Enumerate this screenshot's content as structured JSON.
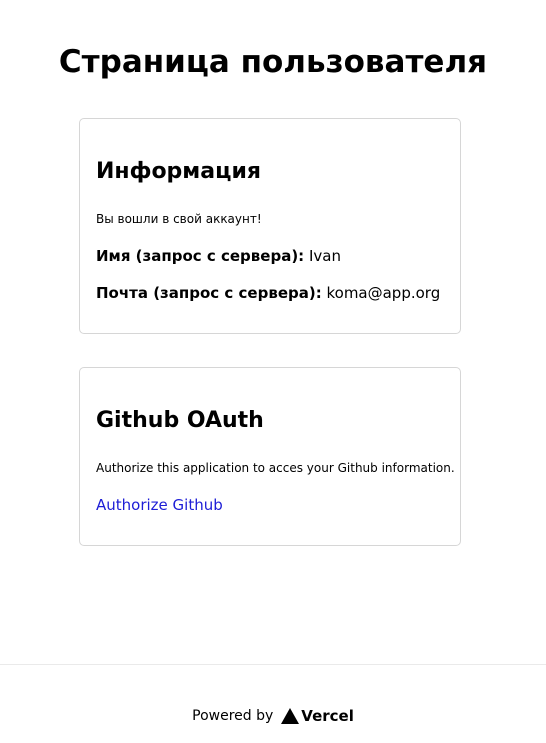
{
  "page": {
    "title": "Страница пользователя"
  },
  "info_card": {
    "heading": "Информация",
    "logged_in_text": "Вы вошли в свой аккаунт!",
    "name_label": "Имя (запрос с сервера):",
    "name_value": "Ivan",
    "email_label": "Почта (запрос с сервера):",
    "email_value": "koma@app.org"
  },
  "github_card": {
    "heading": "Github OAuth",
    "description": "Authorize this application to acces your Github information.",
    "authorize_link": "Authorize Github"
  },
  "footer": {
    "powered_by": "Powered by",
    "logo_text": "Vercel"
  }
}
